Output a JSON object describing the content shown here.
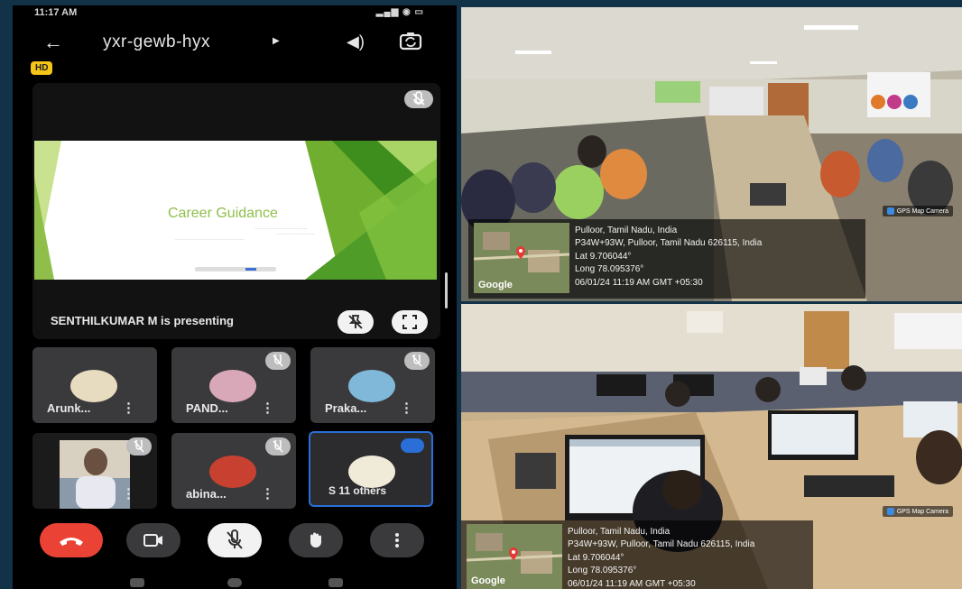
{
  "status_bar": {
    "time": "11:17 AM",
    "icons": "signal wifi battery"
  },
  "meet": {
    "meeting_code": "yxr-gewb-hyx",
    "hd_badge": "HD",
    "slide": {
      "title": "Career Guidance"
    },
    "presenting_label": "SENTHILKUMAR M is presenting",
    "participants": [
      {
        "name": "Arunk...",
        "avatar_color": "#e8dcc0"
      },
      {
        "name": "PAND...",
        "avatar_color": "#d9a8b8"
      },
      {
        "name": "Praka...",
        "avatar_color": "#7fb8d8"
      },
      {
        "name": "",
        "avatar_color": "#6a5a4a"
      },
      {
        "name": "abina...",
        "avatar_color": "#c84030"
      },
      {
        "name": "S",
        "others_label": "11 others",
        "avatar_color": "#f0ead8"
      }
    ],
    "controls": [
      "end-call",
      "camera",
      "mic-off",
      "raise-hand",
      "more-options"
    ]
  },
  "geotags": [
    {
      "location": "Pulloor, Tamil Nadu, India",
      "address": "P34W+93W, Pulloor, Tamil Nadu 626115, India",
      "lat": "Lat 9.706044°",
      "long": "Long 78.095376°",
      "datetime": "06/01/24 11:19 AM GMT +05:30",
      "camera_tag": "GPS Map Camera",
      "map_label": "Google"
    },
    {
      "location": "Pulloor, Tamil Nadu, India",
      "address": "P34W+93W, Pulloor, Tamil Nadu 626115, India",
      "lat": "Lat 9.706044°",
      "long": "Long 78.095376°",
      "datetime": "06/01/24 11:19 AM GMT +05:30",
      "camera_tag": "GPS Map Camera",
      "map_label": "Google"
    }
  ],
  "colors": {
    "end_call": "#ea4335",
    "accent": "#2a6fd8",
    "slide_green": "#8fbf4a"
  }
}
